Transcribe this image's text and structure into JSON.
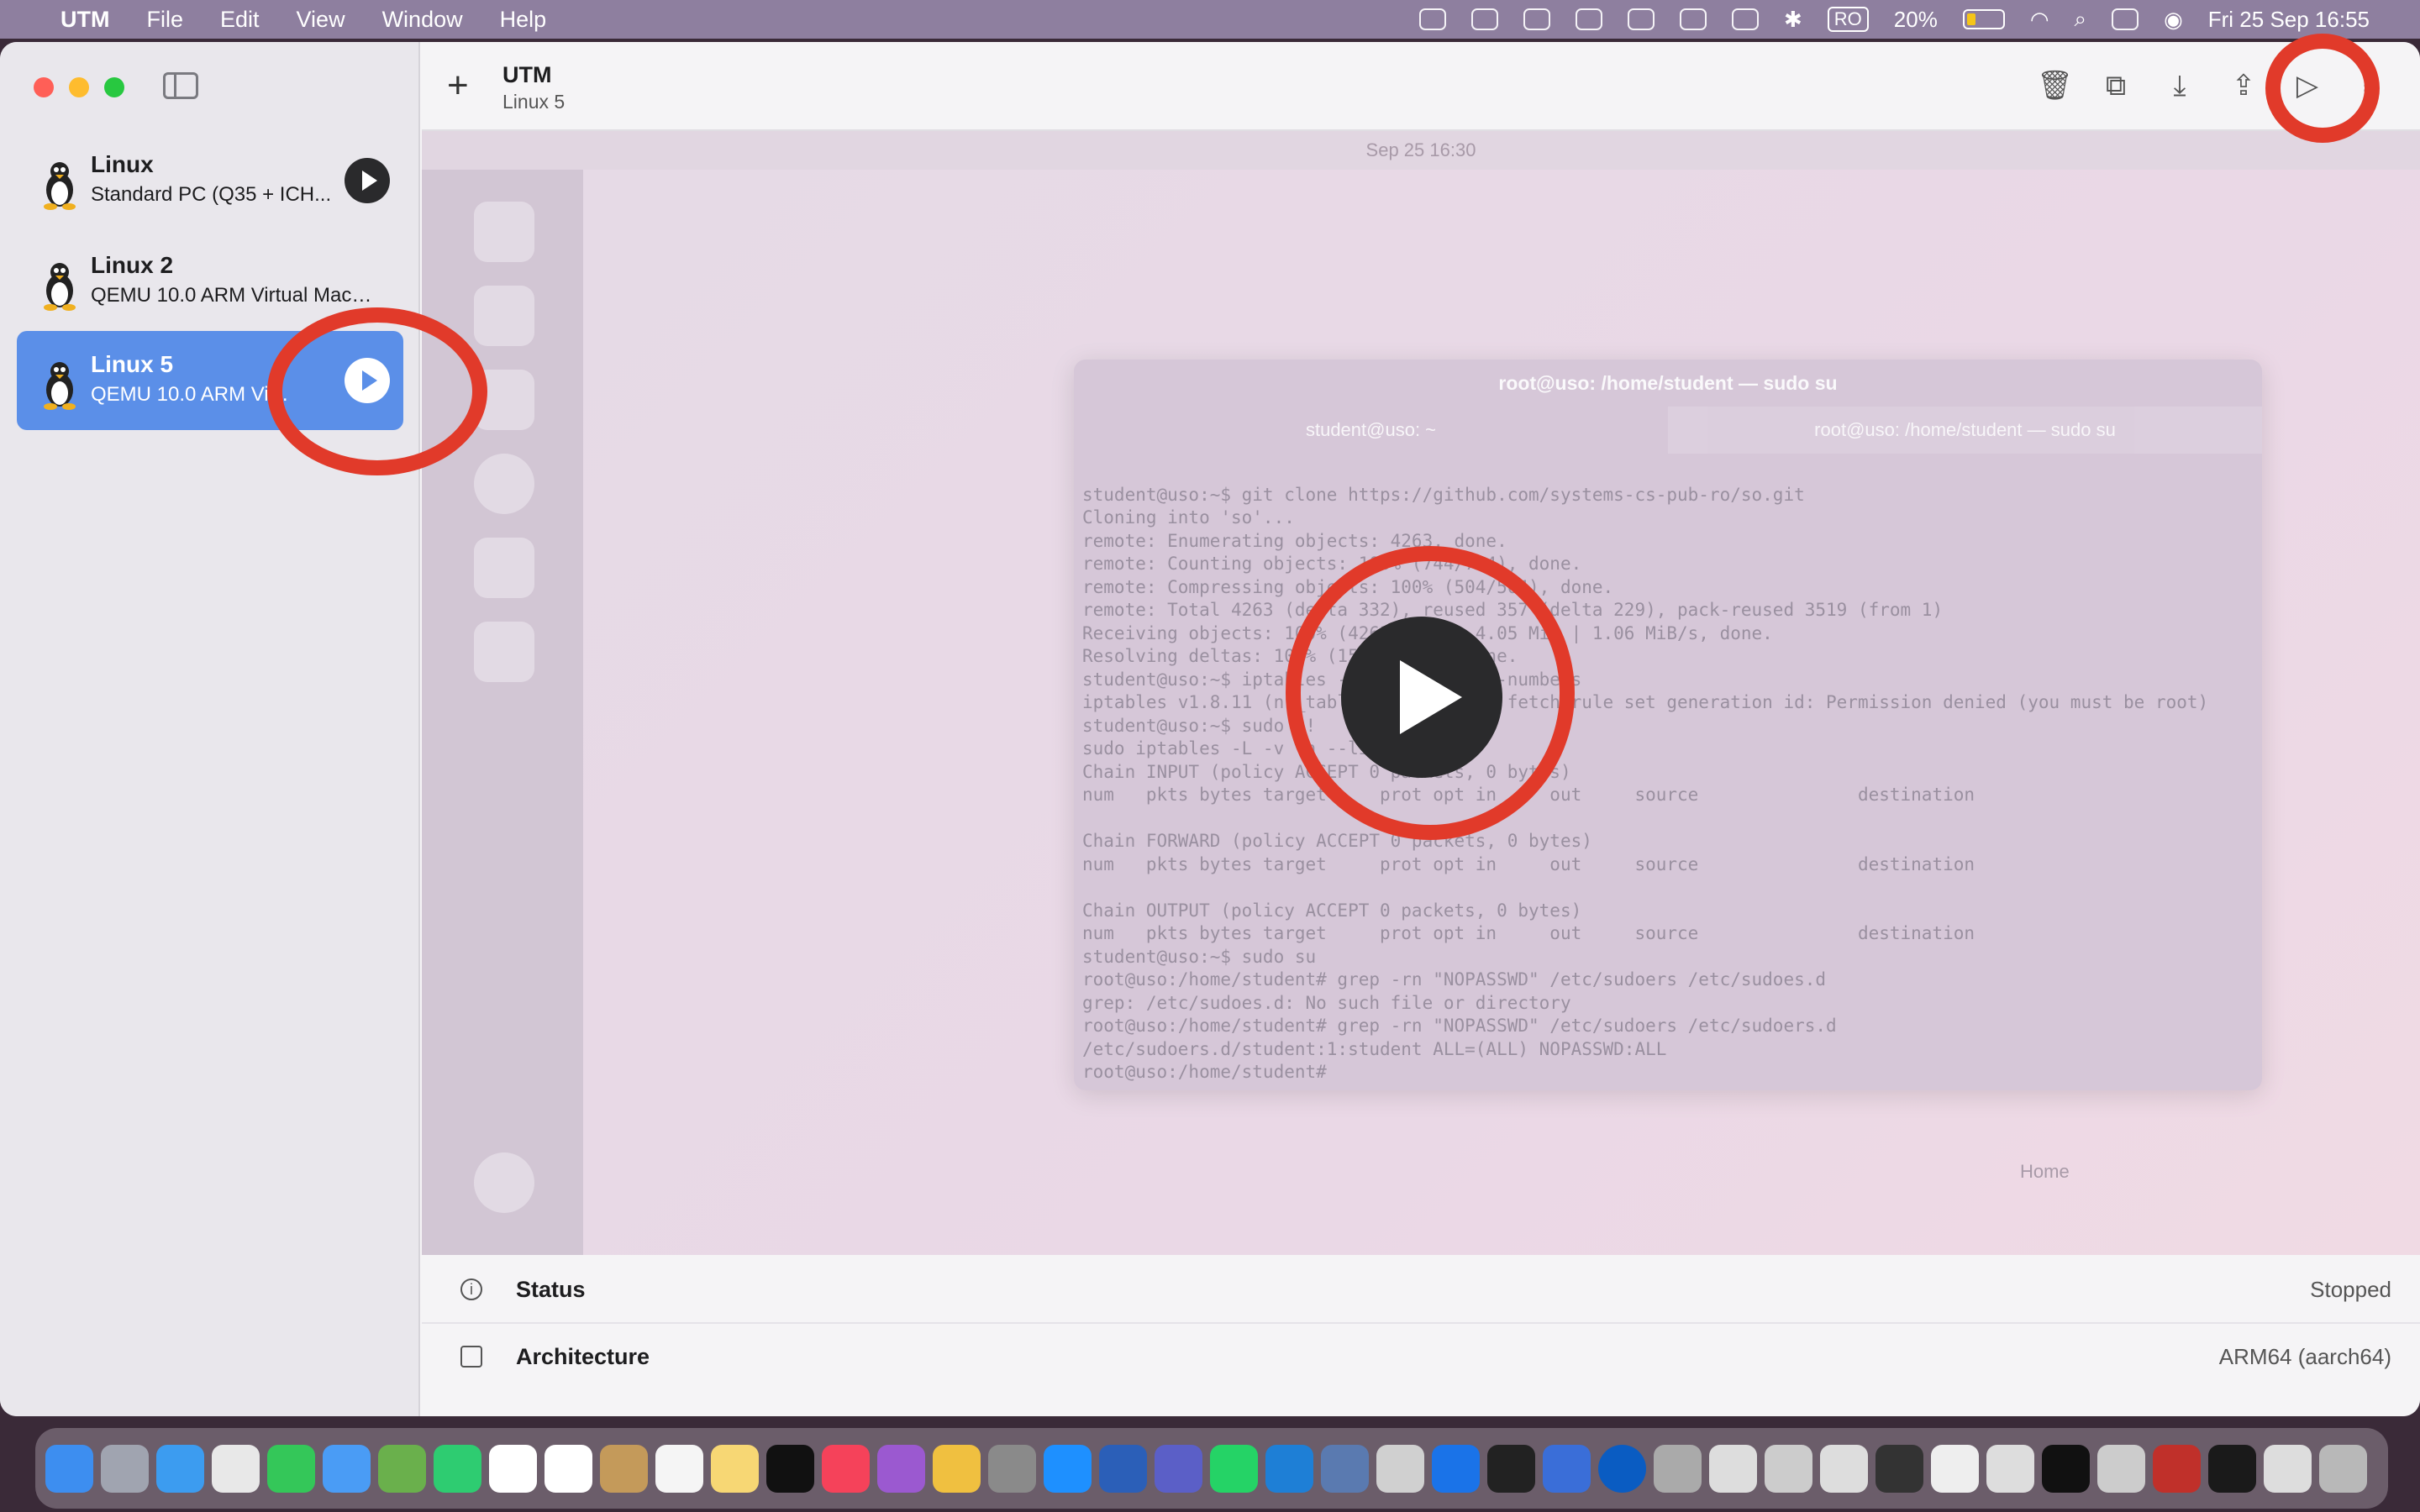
{
  "menubar": {
    "app_name": "UTM",
    "items": [
      "File",
      "Edit",
      "View",
      "Window",
      "Help"
    ],
    "input_source": "RO",
    "battery": "20%",
    "datetime": "Fri 25 Sep  16:55"
  },
  "sidebar": {
    "vms": [
      {
        "name": "Linux",
        "desc": "Standard PC (Q35 + ICH..."
      },
      {
        "name": "Linux 2",
        "desc": "QEMU 10.0 ARM Virtual Machi..."
      },
      {
        "name": "Linux 5",
        "desc": "QEMU 10.0 ARM Virtual..."
      }
    ]
  },
  "toolbar": {
    "title": "UTM",
    "subtitle": "Linux 5",
    "icons": [
      "trash-icon",
      "clone-icon",
      "download-icon",
      "share-icon",
      "play-icon",
      "settings-icon"
    ]
  },
  "preview": {
    "clock": "Sep 25  16:30",
    "terminal_title": "root@uso: /home/student — sudo su",
    "tab1": "student@uso: ~",
    "tab2": "root@uso: /home/student — sudo su",
    "home_label": "Home",
    "lines": [
      "student@uso:~$ git clone https://github.com/systems-cs-pub-ro/so.git",
      "Cloning into 'so'...",
      "remote: Enumerating objects: 4263, done.",
      "remote: Counting objects: 100% (744/744), done.",
      "remote: Compressing objects: 100% (504/504), done.",
      "remote: Total 4263 (delta 332), reused 357 (delta 229), pack-reused 3519 (from 1)",
      "Receiving objects: 100% (4263/4263), 4.05 MiB | 1.06 MiB/s, done.",
      "Resolving deltas: 100% (1546/1546), done.",
      "student@uso:~$ iptables -L -v -n --line-numbers",
      "iptables v1.8.11 (nf_tables): Could not fetch rule set generation id: Permission denied (you must be root)",
      "student@uso:~$ sudo !!",
      "sudo iptables -L -v -n --line-numbers",
      "Chain INPUT (policy ACCEPT 0 packets, 0 bytes)",
      "num   pkts bytes target     prot opt in     out     source               destination",
      "",
      "Chain FORWARD (policy ACCEPT 0 packets, 0 bytes)",
      "num   pkts bytes target     prot opt in     out     source               destination",
      "",
      "Chain OUTPUT (policy ACCEPT 0 packets, 0 bytes)",
      "num   pkts bytes target     prot opt in     out     source               destination",
      "student@uso:~$ sudo su",
      "root@uso:/home/student# grep -rn \"NOPASSWD\" /etc/sudoers /etc/sudoes.d",
      "grep: /etc/sudoes.d: No such file or directory",
      "root@uso:/home/student# grep -rn \"NOPASSWD\" /etc/sudoers /etc/sudoers.d",
      "/etc/sudoers.d/student:1:student ALL=(ALL) NOPASSWD:ALL",
      "root@uso:/home/student# "
    ]
  },
  "info": {
    "status_label": "Status",
    "status_value": "Stopped",
    "arch_label": "Architecture",
    "arch_value": "ARM64 (aarch64)"
  },
  "colors": {
    "selection": "#5b8fe8",
    "annotation": "#e13a2a",
    "menubar": "#8e7f9f"
  }
}
